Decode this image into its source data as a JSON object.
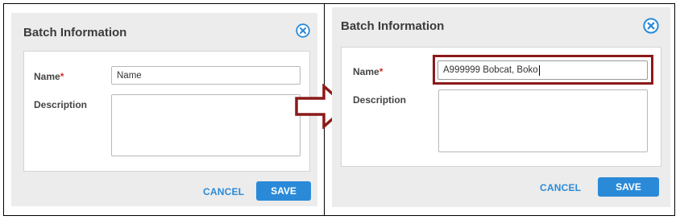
{
  "left_dialog": {
    "title": "Batch Information",
    "name_label": "Name",
    "required_marker": "*",
    "name_placeholder": "Name",
    "name_value": "",
    "description_label": "Description",
    "cancel_label": "CANCEL",
    "save_label": "SAVE"
  },
  "right_dialog": {
    "title": "Batch Information",
    "name_label": "Name",
    "required_marker": "*",
    "name_value": "A999999 Bobcat, Boko",
    "description_label": "Description",
    "cancel_label": "CANCEL",
    "save_label": "SAVE"
  },
  "colors": {
    "accent": "#2a8ad8",
    "highlight": "#8b1a1a",
    "required": "#d0312d"
  },
  "icons": {
    "close": "close-circle-icon",
    "arrow": "right-arrow-icon"
  }
}
